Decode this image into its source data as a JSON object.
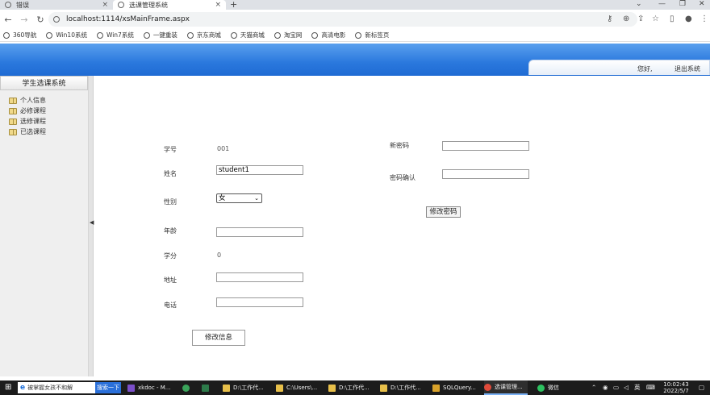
{
  "browser": {
    "tabs": [
      {
        "title": "错误",
        "active": false
      },
      {
        "title": "选课管理系统",
        "active": true
      }
    ],
    "url": "localhost:1114/xsMainFrame.aspx",
    "bookmarks": [
      "360导航",
      "Win10系统",
      "Win7系统",
      "一键重装",
      "京东商城",
      "天猫商城",
      "淘宝网",
      "高清电影",
      "新标签页"
    ]
  },
  "header": {
    "greeting": "您好,",
    "logout": "退出系统"
  },
  "sidebar": {
    "title": "学生选课系统",
    "items": [
      "个人信息",
      "必修课程",
      "选修课程",
      "已选课程"
    ]
  },
  "form": {
    "student_id_label": "学号",
    "student_id_value": "001",
    "name_label": "姓名",
    "name_value": "student1",
    "gender_label": "性别",
    "gender_value": "女",
    "age_label": "年龄",
    "age_value": "",
    "credits_label": "学分",
    "credits_value": "0",
    "address_label": "地址",
    "address_value": "",
    "phone_label": "电话",
    "phone_value": "",
    "update_button": "修改信息",
    "new_password_label": "新密码",
    "confirm_password_label": "密码确认",
    "change_password_button": "修改密码"
  },
  "taskbar": {
    "start_app": "被掌握女孩不和解",
    "search": "搜索一下",
    "items": [
      "xkdoc - M...",
      "D:\\工作代...",
      "C:\\Users\\...",
      "D:\\工作代...",
      "D:\\工作代...",
      "SQLQuery...",
      "选课管理...",
      "微信"
    ],
    "ime": "英",
    "time": "10:02:43",
    "date": "2022/5/7"
  },
  "colors": {
    "banner": "#2a78dd",
    "sidebar_bg": "#efefef"
  }
}
